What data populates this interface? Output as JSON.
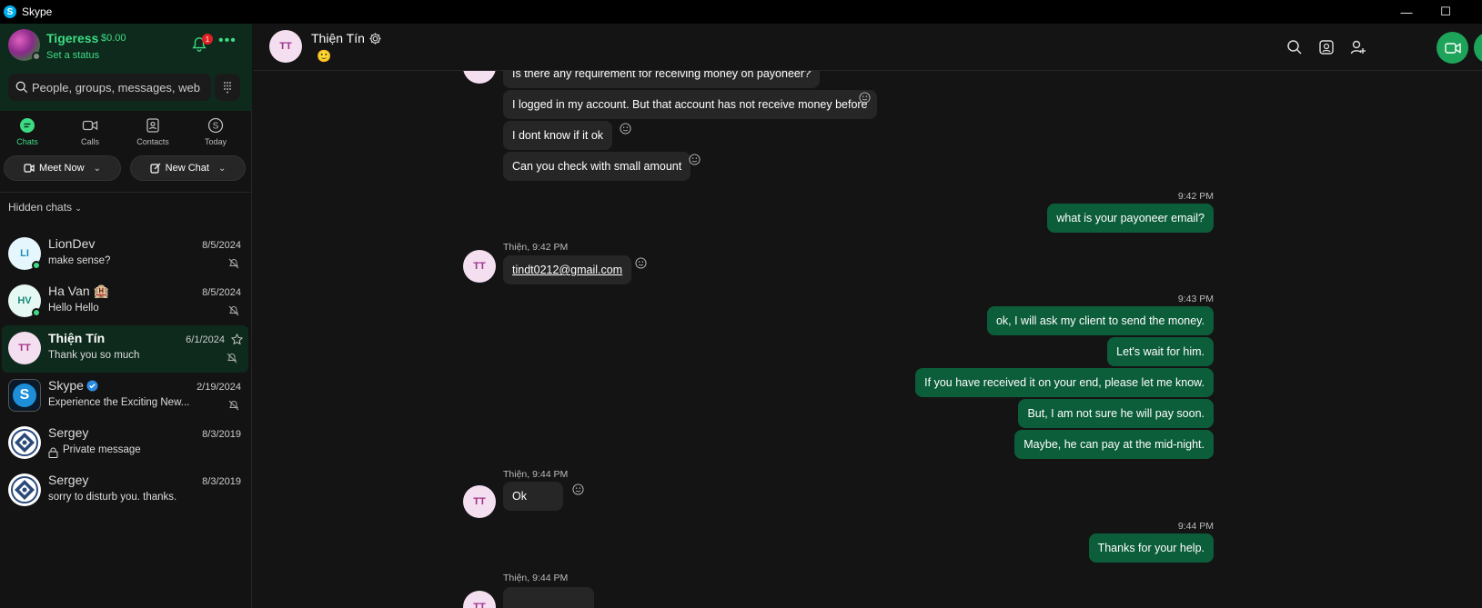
{
  "window": {
    "title": "Skype",
    "minimize": "—",
    "maximize": "☐"
  },
  "profile": {
    "name": "Tigeress",
    "balance": "$0.00",
    "status": "Set a status",
    "notifications": "1",
    "more": "•••"
  },
  "search": {
    "placeholder": "People, groups, messages, web"
  },
  "nav": {
    "tabs": [
      {
        "label": "Chats"
      },
      {
        "label": "Calls"
      },
      {
        "label": "Contacts"
      },
      {
        "label": "Today"
      }
    ]
  },
  "actions": {
    "meet_now": "Meet Now",
    "new_chat": "New Chat"
  },
  "hidden_chats_label": "Hidden chats",
  "chats": [
    {
      "initials": "LI",
      "name": "LionDev",
      "date": "8/5/2024",
      "preview": "make sense?"
    },
    {
      "initials": "HV",
      "name": "Ha Van 🏨",
      "date": "8/5/2024",
      "preview": "Hello Hello"
    },
    {
      "initials": "TT",
      "name": "Thiện Tín",
      "date": "6/1/2024",
      "preview": "Thank you so much"
    },
    {
      "initials": "S",
      "name": "Skype",
      "date": "2/19/2024",
      "preview": "Experience the Exciting New..."
    },
    {
      "initials": "",
      "name": "Sergey",
      "date": "8/3/2019",
      "preview": "Private message"
    },
    {
      "initials": "",
      "name": "Sergey",
      "date": "8/3/2019",
      "preview": "sorry to disturb you. thanks."
    }
  ],
  "conversation": {
    "contact_initials": "TT",
    "contact_name": "Thiện Tín",
    "mood": "🙂",
    "messages": {
      "m1": "Is there any requirement for receiving money on payoneer?",
      "m2": "I logged in my account. But that account has not receive money before",
      "m3": "I dont know if it ok",
      "m4": "Can you check with small amount",
      "t1": "9:42 PM",
      "m5": "what is your payoneer email?",
      "s1": "Thiện, 9:42 PM",
      "m6": "tindt0212@gmail.com",
      "t2": "9:43 PM",
      "m7": "ok, I will ask my client to send the money.",
      "m8": "Let's wait for him.",
      "m9": "If you have received it on your end, please let me know.",
      "m10": "But, I am not sure he will pay soon.",
      "m11": "Maybe, he can pay at the mid-night.",
      "s2": "Thiện, 9:44 PM",
      "m12": "Ok",
      "t3": "9:44 PM",
      "m13": "Thanks for your help.",
      "s3": "Thiện, 9:44 PM"
    }
  },
  "colors": {
    "accent": "#3ddc84",
    "outgoing_bubble": "#0c5d3a",
    "incoming_bubble": "#262626",
    "active_bg": "#0e2a1d"
  }
}
